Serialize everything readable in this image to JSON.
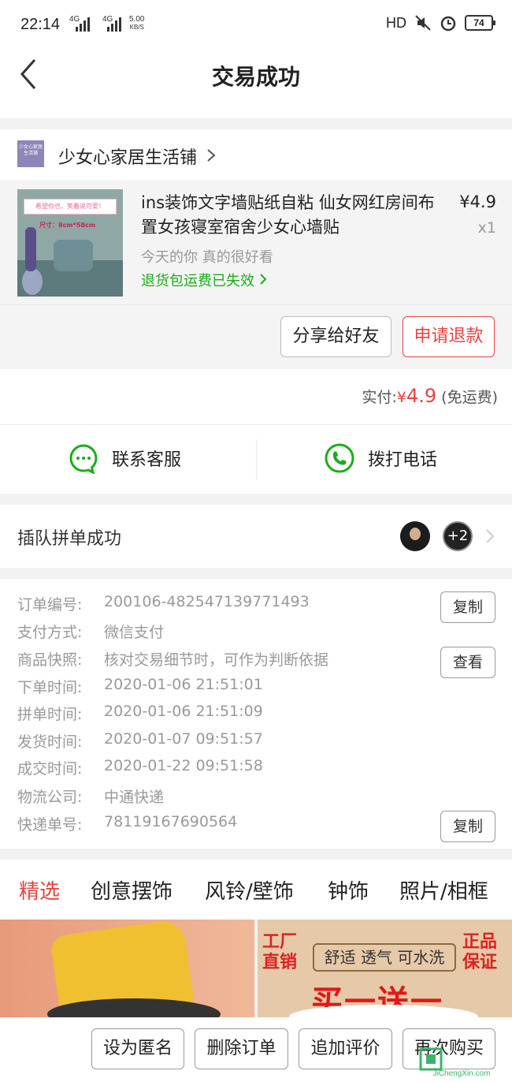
{
  "status": {
    "time": "22:14",
    "sim1": "4G",
    "sim2": "4G",
    "speed_value": "5.00",
    "speed_unit": "KB/S",
    "hd": "HD",
    "battery": "74"
  },
  "nav": {
    "title": "交易成功"
  },
  "shop": {
    "logo_text": "少女心家居生活铺",
    "name": "少女心家居生活铺"
  },
  "product": {
    "thumb_caption1": "希望你也，笑着说可爱！",
    "thumb_caption2": "尺寸：8cm*58cm",
    "title": "ins装饰文字墙贴纸自粘 仙女网红房间布置女孩寝室宿舍少女心墙贴",
    "price": "¥4.9",
    "qty": "x1",
    "spec": "今天的你 真的很好看",
    "return_notice": "退货包运费已失效"
  },
  "actions": {
    "share": "分享给好友",
    "refund": "申请退款"
  },
  "payment": {
    "label": "实付:",
    "currency": "¥",
    "amount": "4.9",
    "shipping": "(免运费)"
  },
  "contact": {
    "service": "联系客服",
    "phone": "拨打电话"
  },
  "group": {
    "text": "插队拼单成功",
    "extra_count": "+2"
  },
  "order": {
    "rows": [
      {
        "label": "订单编号:",
        "value": "200106-482547139771493"
      },
      {
        "label": "支付方式:",
        "value": "微信支付"
      },
      {
        "label": "商品快照:",
        "value": "核对交易细节时，可作为判断依据"
      },
      {
        "label": "下单时间:",
        "value": "2020-01-06 21:51:01"
      },
      {
        "label": "拼单时间:",
        "value": "2020-01-06 21:51:09"
      },
      {
        "label": "发货时间:",
        "value": "2020-01-07 09:51:57"
      },
      {
        "label": "成交时间:",
        "value": "2020-01-22 09:51:58"
      },
      {
        "label": "物流公司:",
        "value": "中通快递"
      },
      {
        "label": "快递单号:",
        "value": "78119167690564"
      }
    ],
    "copy_label": "复制",
    "view_label": "查看"
  },
  "tabs": [
    "精选",
    "创意摆饰",
    "风铃/壁饰",
    "钟饰",
    "照片/相框"
  ],
  "banner": {
    "tag1": "工厂",
    "tag2": "直销",
    "features": "舒适 透气 可水洗",
    "genuine1": "正品",
    "genuine2": "保证",
    "promo": "买一送一"
  },
  "bottom": {
    "anonymous": "设为匿名",
    "delete": "删除订单",
    "review": "追加评价",
    "rebuy": "再次购买"
  },
  "watermark": {
    "text": "JiChengXin.com"
  },
  "colors": {
    "accent": "#e64340",
    "green": "#1aad19"
  }
}
